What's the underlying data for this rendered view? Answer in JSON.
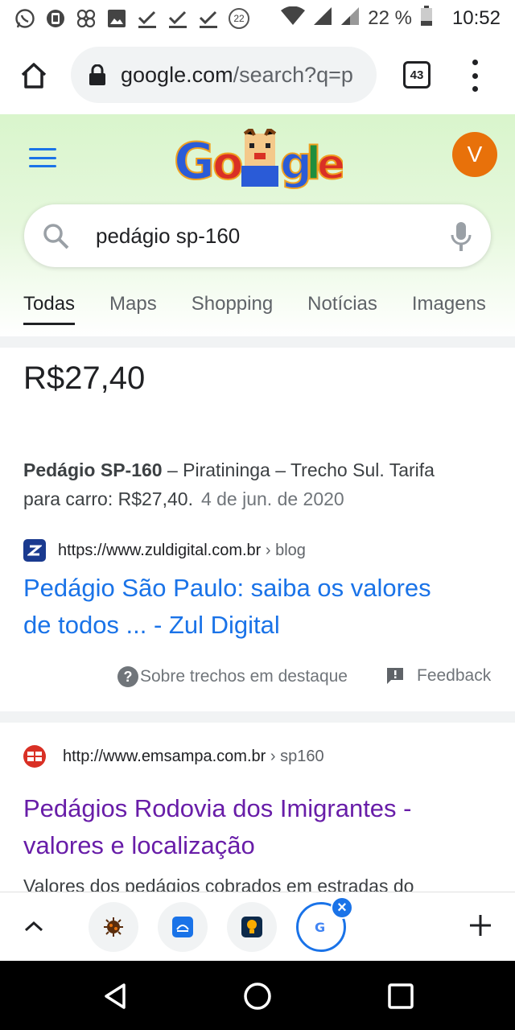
{
  "status_bar": {
    "notification_count": "22",
    "battery": "22 %",
    "time": "10:52",
    "icons": [
      "whatsapp-icon",
      "sim-icon",
      "fan-icon",
      "image-icon",
      "check-icon",
      "check-icon",
      "check-icon",
      "badge-count-icon",
      "wifi-icon",
      "signal-icon",
      "signal-icon",
      "battery-icon"
    ]
  },
  "browser": {
    "url_main": "google.com",
    "url_rest": "/search?q=p",
    "tab_count": "43"
  },
  "google": {
    "avatar_letter": "V",
    "search_query": "pedágio sp-160",
    "tabs": [
      "Todas",
      "Maps",
      "Shopping",
      "Notícias",
      "Imagens"
    ],
    "active_tab": "Todas"
  },
  "featured_snippet": {
    "answer": "R$27,40",
    "snippet_bold": "Pedágio SP-160",
    "snippet_line1_rest": " – Piratininga – Trecho Sul. Tarifa",
    "snippet_line2": "para carro: R$27,40.",
    "date": "4 de jun. de 2020",
    "site_url": "https://www.zuldigital.com.br",
    "site_crumb": " › blog",
    "title_line1": "Pedágio São Paulo: saiba os valores",
    "title_line2": "de todos ... - Zul Digital",
    "about_label": "Sobre trechos em destaque",
    "feedback_label": "Feedback"
  },
  "result2": {
    "site_url": "http://www.emsampa.com.br",
    "site_crumb": " › sp160",
    "title_line1": "Pedágios Rodovia dos Imigrantes -",
    "title_line2": "valores e localização",
    "snippet": "Valores dos pedágios cobrados em estradas do"
  },
  "colors": {
    "link_blue": "#1a73e8",
    "visited_purple": "#681da8",
    "avatar": "#e8710a",
    "header_green": "#d9f5cc"
  }
}
